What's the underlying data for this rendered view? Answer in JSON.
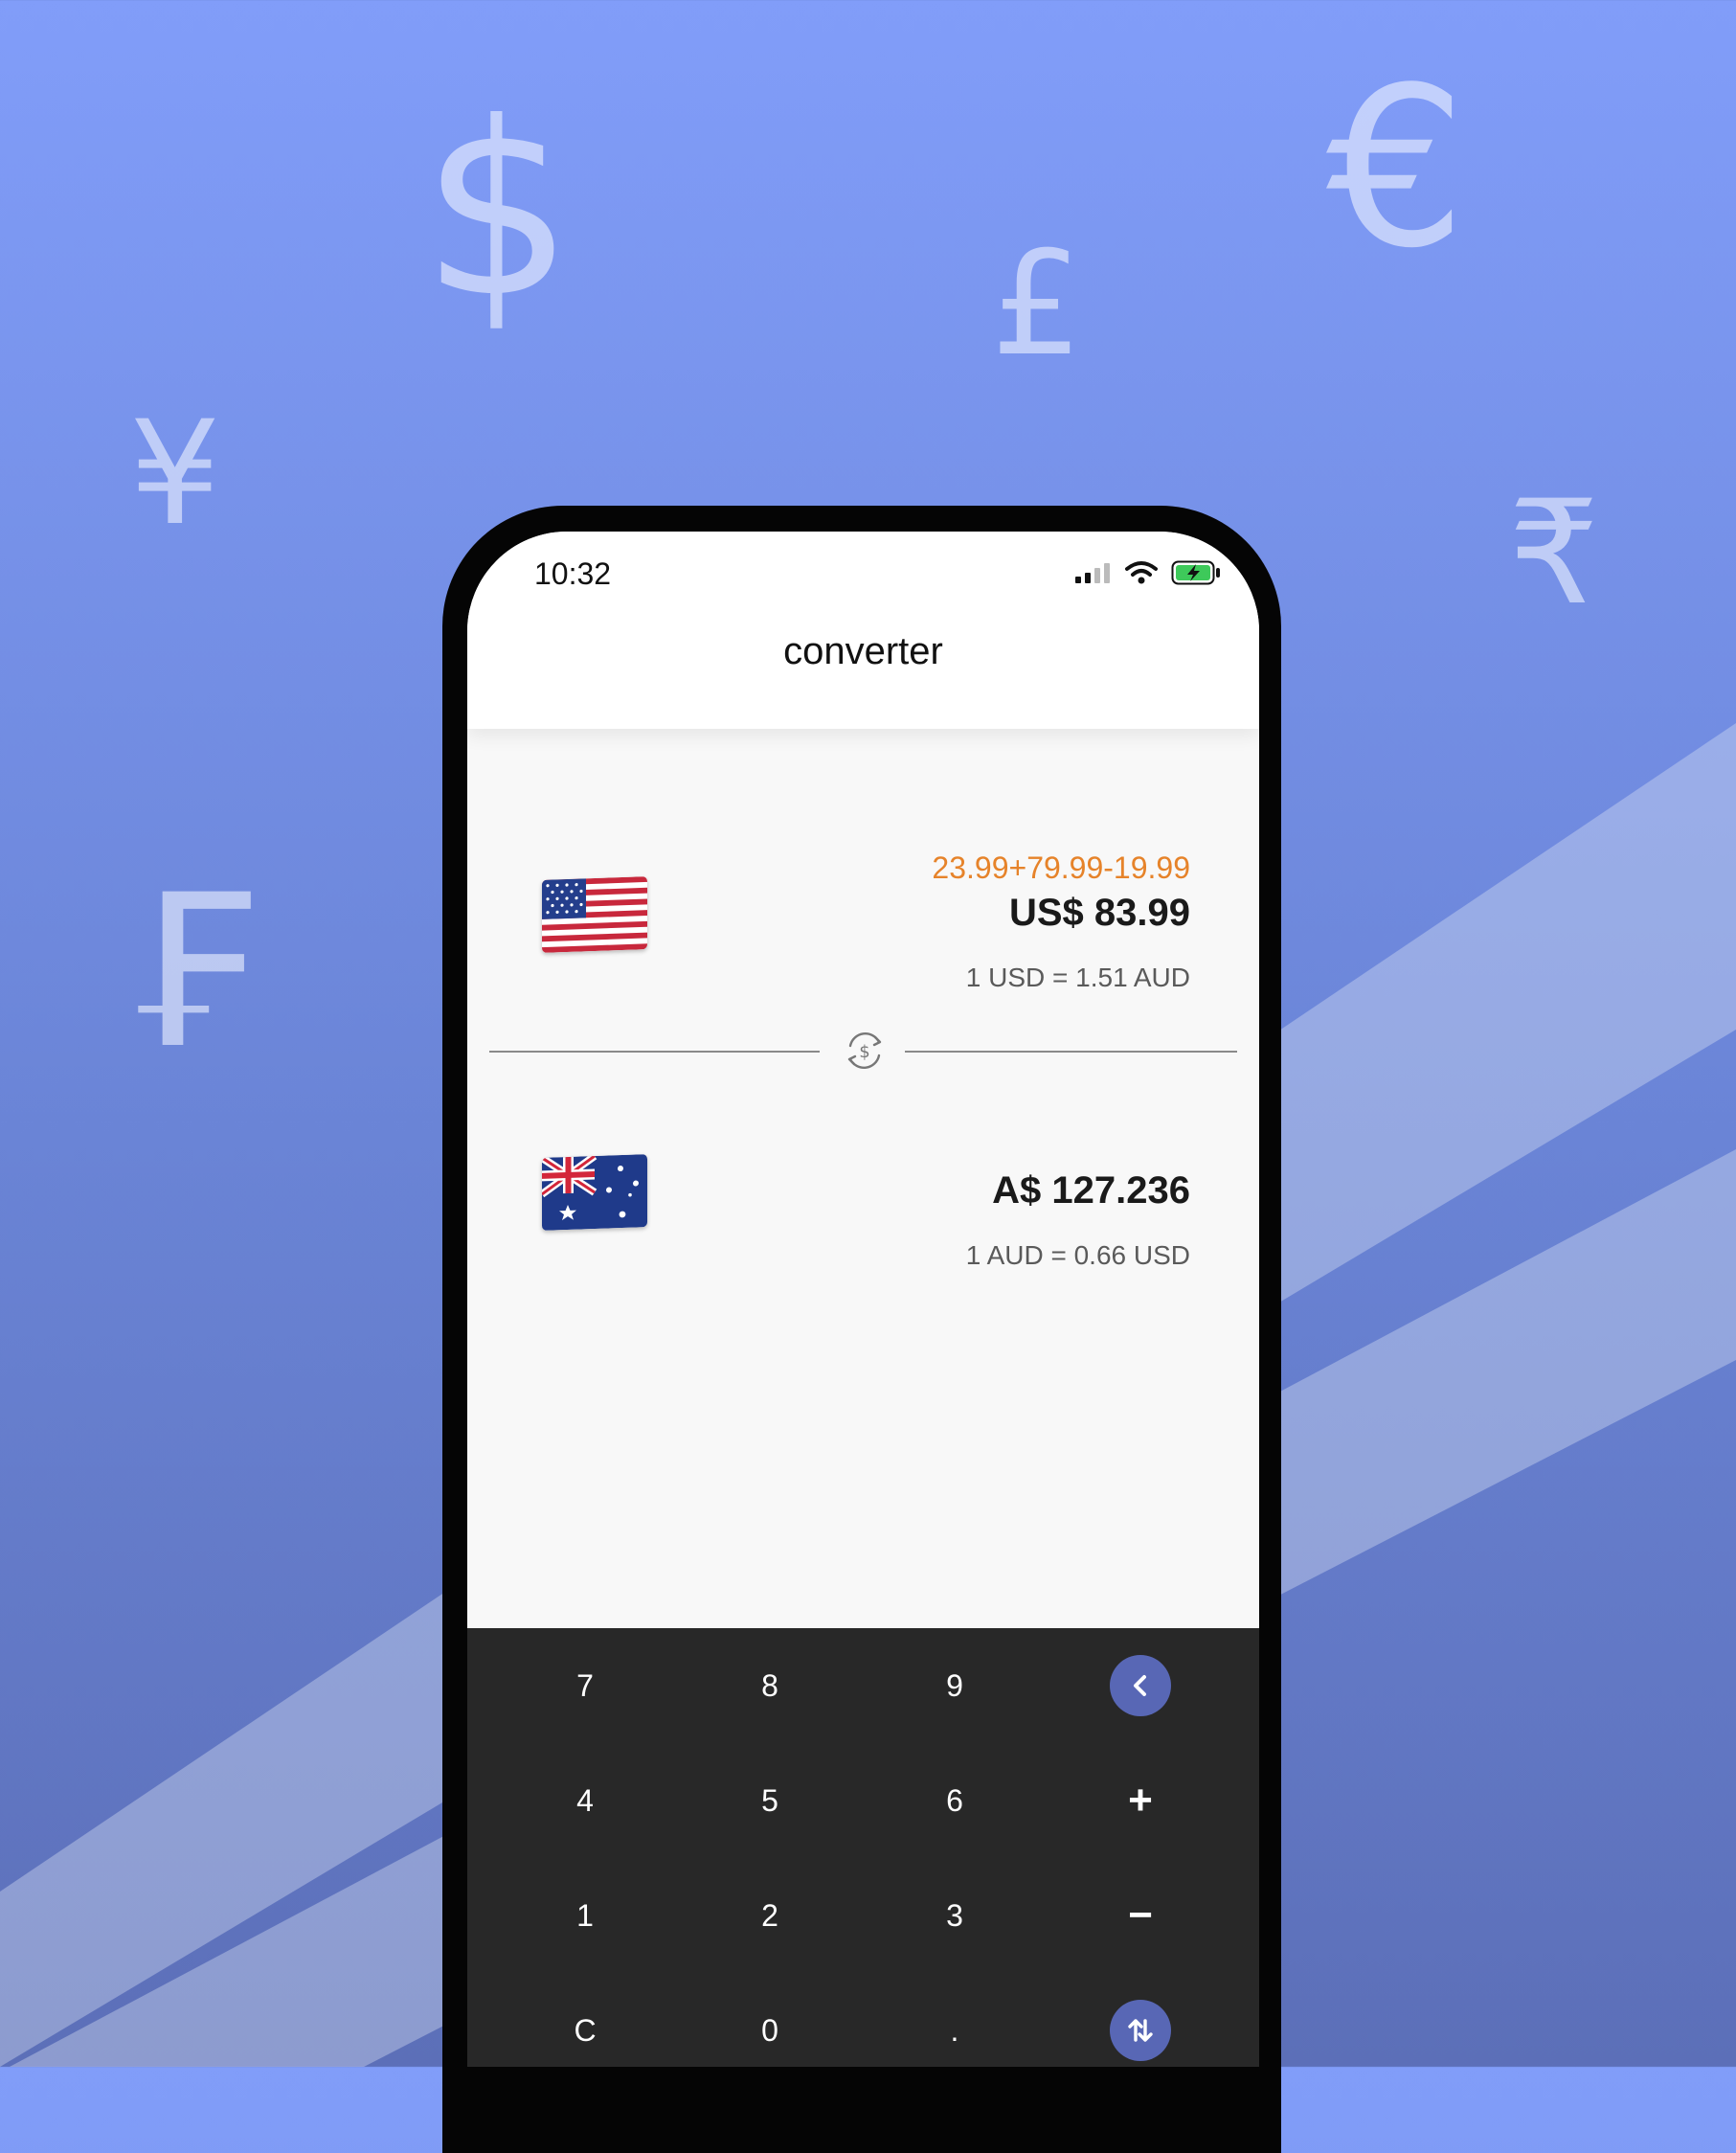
{
  "background": {
    "gradient_top": "#819df9",
    "gradient_bottom": "#5c6fb8",
    "currency_symbols": {
      "dollar": "$",
      "euro": "€",
      "pound": "£",
      "yen": "¥",
      "rupee": "₹",
      "franc": "₣"
    }
  },
  "status_bar": {
    "time": "10:32",
    "icons": [
      "cellular-signal-icon",
      "wifi-icon",
      "battery-charging-icon"
    ]
  },
  "header": {
    "title": "converter"
  },
  "from_currency": {
    "flag": "us-flag-icon",
    "expression": "23.99+79.99-19.99",
    "amount": "US$ 83.99",
    "rate": "1 USD = 1.51 AUD"
  },
  "divider": {
    "icon": "currency-swap-icon"
  },
  "to_currency": {
    "flag": "au-flag-icon",
    "amount": "A$ 127.236",
    "rate": "1 AUD = 0.66 USD"
  },
  "keypad": {
    "keys": {
      "k7": "7",
      "k8": "8",
      "k9": "9",
      "k4": "4",
      "k5": "5",
      "k6": "6",
      "k1": "1",
      "k2": "2",
      "k3": "3",
      "kc": "C",
      "k0": "0",
      "kdot": "."
    },
    "plus": "+",
    "minus": "−",
    "backspace_icon": "chevron-left-icon",
    "swap_icon": "swap-vertical-icon",
    "accent": "#5867b5"
  },
  "colors": {
    "expression": "#e6832a",
    "keypad_background": "#282828"
  }
}
